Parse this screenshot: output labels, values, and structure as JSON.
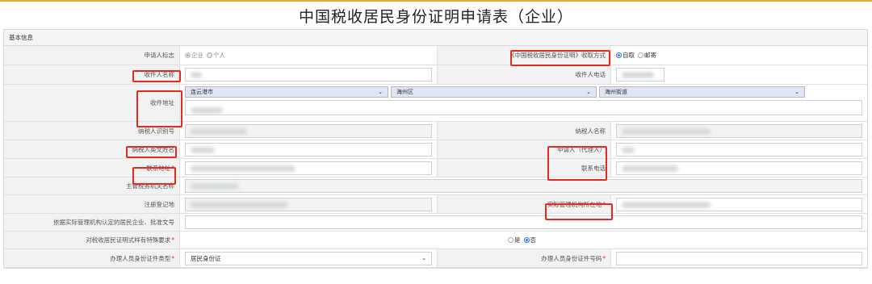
{
  "title": "中国税收居民身份证明申请表（企业）",
  "section": "基本信息",
  "rows": {
    "applicant_type": {
      "label": "申请人标志",
      "options": [
        "企业",
        "个人"
      ]
    },
    "receive_method": {
      "label": "《中国税收居民身份证明》收取方式",
      "options": [
        "自取",
        "邮寄"
      ]
    },
    "recipient_name": {
      "label": "收件人名称"
    },
    "recipient_phone": {
      "label": "收件人电话"
    },
    "recipient_address": {
      "label": "收件地址",
      "city": "连云港市",
      "district": "海州区",
      "street": "海州街道"
    },
    "taxpayer_id": {
      "label": "纳税人识别号"
    },
    "taxpayer_name": {
      "label": "纳税人名称"
    },
    "english_name": {
      "label": "纳税人英文姓名"
    },
    "agent": {
      "label": "申请人（代理人）"
    },
    "contact_address": {
      "label": "联系地址"
    },
    "contact_phone": {
      "label": "联系电话"
    },
    "tax_authority": {
      "label": "主管税务机关名称"
    },
    "registered_place": {
      "label": "注册登记地"
    },
    "actual_management": {
      "label": "实际管理机构所在地"
    },
    "approval_doc": {
      "label": "依据实际管理机构认定的居民企业、批准文号"
    },
    "special_format": {
      "label": "对税收居民证明式样有特殊要求",
      "options": [
        "是",
        "否"
      ]
    },
    "handler_id_type": {
      "label": "办理人员身份证件类型",
      "value": "居民身份证"
    },
    "handler_id_no": {
      "label": "办理人员身份证件号码"
    }
  },
  "colors": {
    "accent": "#f0a63c",
    "highlight": "#e8291f",
    "radio": "#1e73e8"
  }
}
